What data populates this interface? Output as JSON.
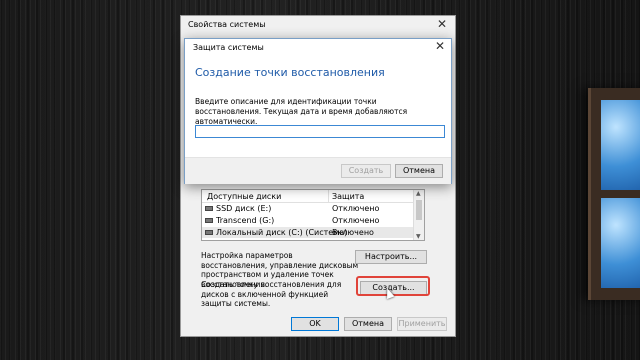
{
  "system_properties": {
    "title": "Свойства системы",
    "close_symbol": "✕",
    "disks_table": {
      "headers": [
        "Доступные диски",
        "Защита"
      ],
      "rows": [
        {
          "name": "SSD диск (E:)",
          "status": "Отключено"
        },
        {
          "name": "Transcend (G:)",
          "status": "Отключено"
        },
        {
          "name": "Локальный диск (C:) (Система)",
          "status": "Включено"
        }
      ]
    },
    "configure_text": "Настройка параметров восстановления, управление дисковым пространством и удаление точек восстановления.",
    "configure_button": "Настроить...",
    "create_text": "Создать точку восстановления для дисков с включенной функцией защиты системы.",
    "create_button": "Создать...",
    "ok_button": "OK",
    "cancel_button": "Отмена",
    "apply_button": "Применить"
  },
  "dialog": {
    "title": "Защита системы",
    "close_symbol": "✕",
    "heading": "Создание точки восстановления",
    "description": "Введите описание для идентификации точки восстановления. Текущая дата и время добавляются автоматически.",
    "input_value": "",
    "create_button": "Создать",
    "cancel_button": "Отмена"
  },
  "colors": {
    "heading": "#1e5aa8",
    "highlight": "#e0443a",
    "input_border": "#3c88d4"
  }
}
